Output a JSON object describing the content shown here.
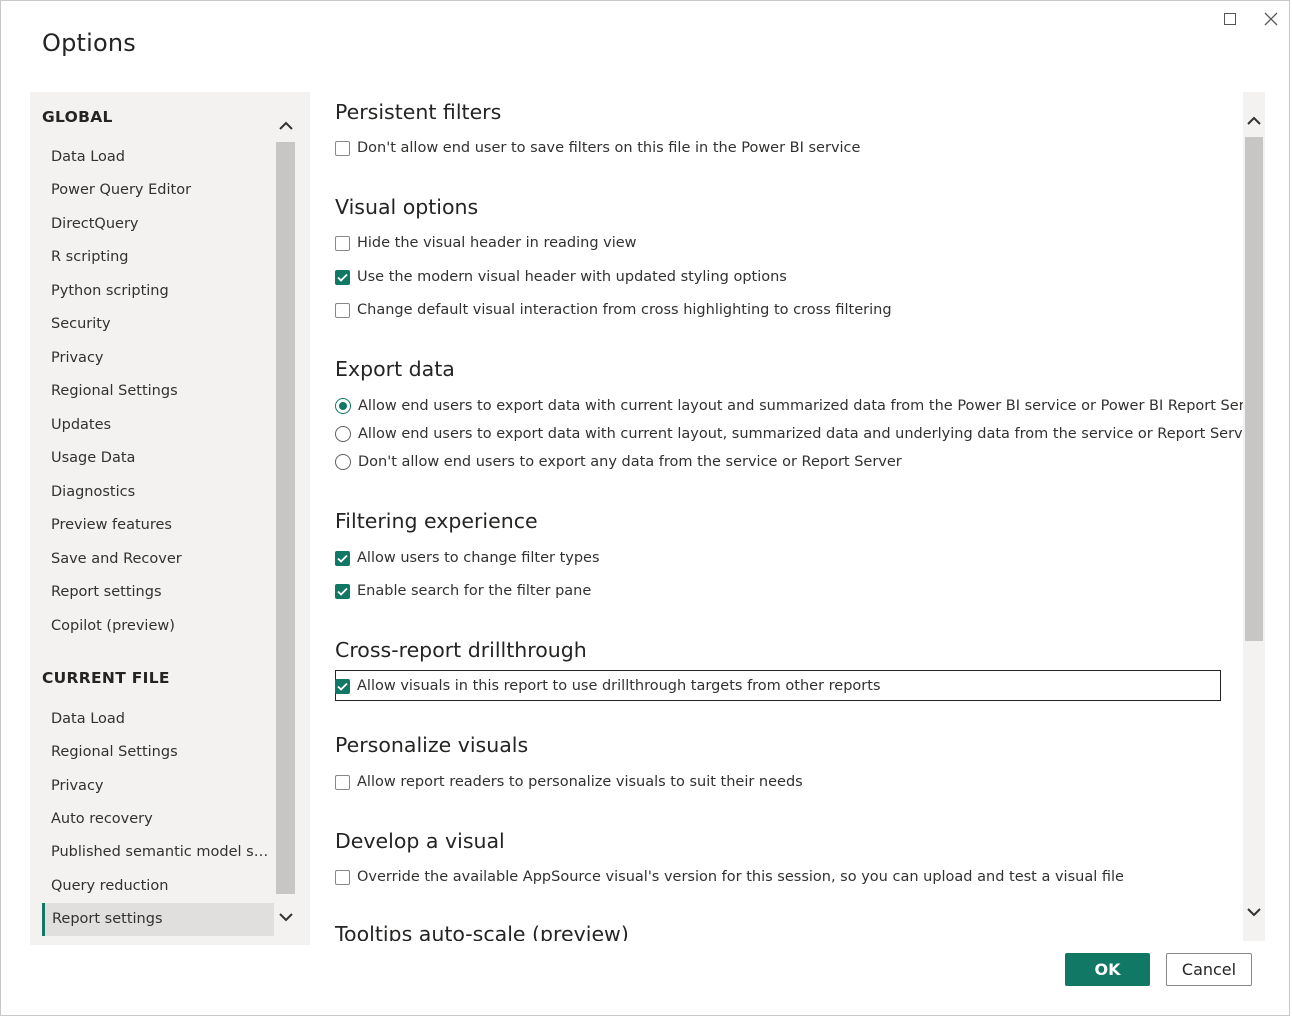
{
  "dialog": {
    "title": "Options",
    "window_controls": {
      "maximize_icon": "maximize-icon",
      "close_icon": "close-icon"
    }
  },
  "nav": {
    "global_header": "GLOBAL",
    "global_items": [
      "Data Load",
      "Power Query Editor",
      "DirectQuery",
      "R scripting",
      "Python scripting",
      "Security",
      "Privacy",
      "Regional Settings",
      "Updates",
      "Usage Data",
      "Diagnostics",
      "Preview features",
      "Save and Recover",
      "Report settings",
      "Copilot (preview)"
    ],
    "current_file_header": "CURRENT FILE",
    "current_file_items": [
      "Data Load",
      "Regional Settings",
      "Privacy",
      "Auto recovery",
      "Published semantic model settings",
      "Query reduction",
      "Report settings"
    ],
    "selected": "Report settings"
  },
  "content": {
    "sections": [
      {
        "title": "Persistent filters",
        "options": [
          {
            "type": "checkbox",
            "label": "Don't allow end user to save filters on this file in the Power BI service",
            "checked": false
          }
        ]
      },
      {
        "title": "Visual options",
        "options": [
          {
            "type": "checkbox",
            "label": "Hide the visual header in reading view",
            "checked": false
          },
          {
            "type": "checkbox",
            "label": "Use the modern visual header with updated styling options",
            "checked": true
          },
          {
            "type": "checkbox",
            "label": "Change default visual interaction from cross highlighting to cross filtering",
            "checked": false
          }
        ]
      },
      {
        "title": "Export data",
        "options": [
          {
            "type": "radio",
            "label": "Allow end users to export data with current layout and summarized data from the Power BI service or Power BI Report Server",
            "checked": true
          },
          {
            "type": "radio",
            "label": "Allow end users to export data with current layout, summarized data and underlying data from the service or Report Server",
            "checked": false
          },
          {
            "type": "radio",
            "label": "Don't allow end users to export any data from the service or Report Server",
            "checked": false
          }
        ]
      },
      {
        "title": "Filtering experience",
        "options": [
          {
            "type": "checkbox",
            "label": "Allow users to change filter types",
            "checked": true
          },
          {
            "type": "checkbox",
            "label": "Enable search for the filter pane",
            "checked": true
          }
        ]
      },
      {
        "title": "Cross-report drillthrough",
        "options": [
          {
            "type": "checkbox",
            "label": "Allow visuals in this report to use drillthrough targets from other reports",
            "checked": true
          }
        ]
      },
      {
        "title": "Personalize visuals",
        "options": [
          {
            "type": "checkbox",
            "label": "Allow report readers to personalize visuals to suit their needs",
            "checked": false
          }
        ]
      },
      {
        "title": "Develop a visual",
        "options": [
          {
            "type": "checkbox",
            "label": "Override the available AppSource visual's version for this session, so you can upload and test a visual file",
            "checked": false
          }
        ]
      },
      {
        "title": "Tooltips auto-scale (preview)",
        "options": []
      }
    ]
  },
  "footer": {
    "ok_label": "OK",
    "cancel_label": "Cancel"
  },
  "colors": {
    "accent": "#117865",
    "nav_background": "#f3f2f1",
    "selected_background": "#e1dfdd"
  }
}
